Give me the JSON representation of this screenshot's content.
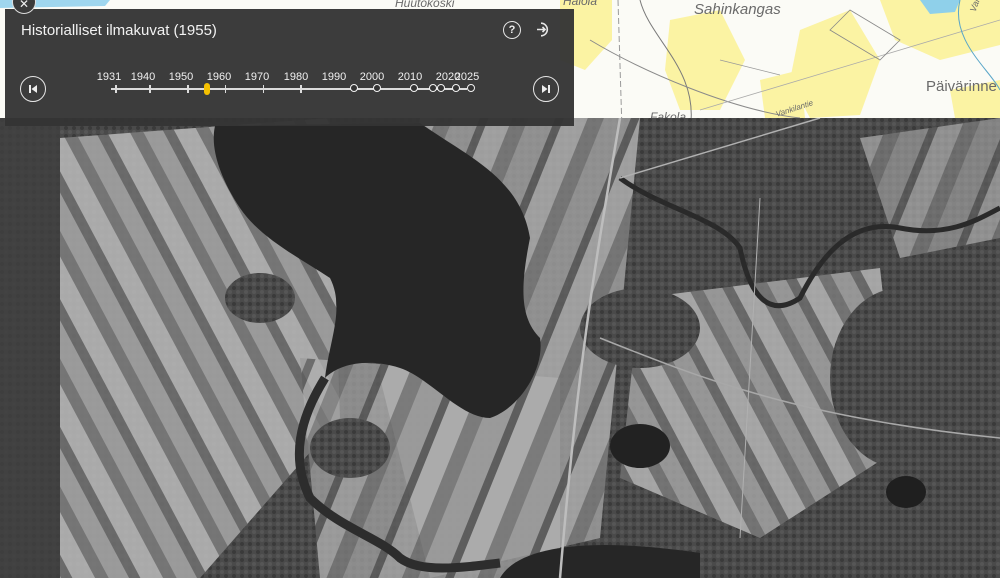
{
  "panel": {
    "title": "Historialliset ilmakuvat (1955)",
    "help_icon": "question-circle-icon",
    "exit_icon": "exit-icon",
    "prev_icon": "skip-previous-icon",
    "next_icon": "skip-next-icon",
    "selected_year": 1955,
    "accent": "#f5c000"
  },
  "timeline": {
    "labels": [
      {
        "text": "1931"
      },
      {
        "text": "1940"
      },
      {
        "text": "1950"
      },
      {
        "text": "1960"
      },
      {
        "text": "1970"
      },
      {
        "text": "1980"
      },
      {
        "text": "1990"
      },
      {
        "text": "2000"
      },
      {
        "text": "2010"
      },
      {
        "text": "2020"
      },
      {
        "text": "2025"
      }
    ],
    "start_year": 1931,
    "end_year": 2025,
    "tick_years": [
      1931,
      1940,
      1950,
      1960,
      1970,
      1980
    ],
    "available_years": [
      1994,
      2000,
      2010,
      2015,
      2017,
      2021,
      2025
    ]
  },
  "map_labels": {
    "huutokoski": "Huutokoski",
    "halola": "Halola",
    "sahinkangas": "Sahinkangas",
    "paivarinne": "Päivärinne",
    "fakola": "Fakola",
    "road": "Vankilantie",
    "edge": "Var"
  }
}
